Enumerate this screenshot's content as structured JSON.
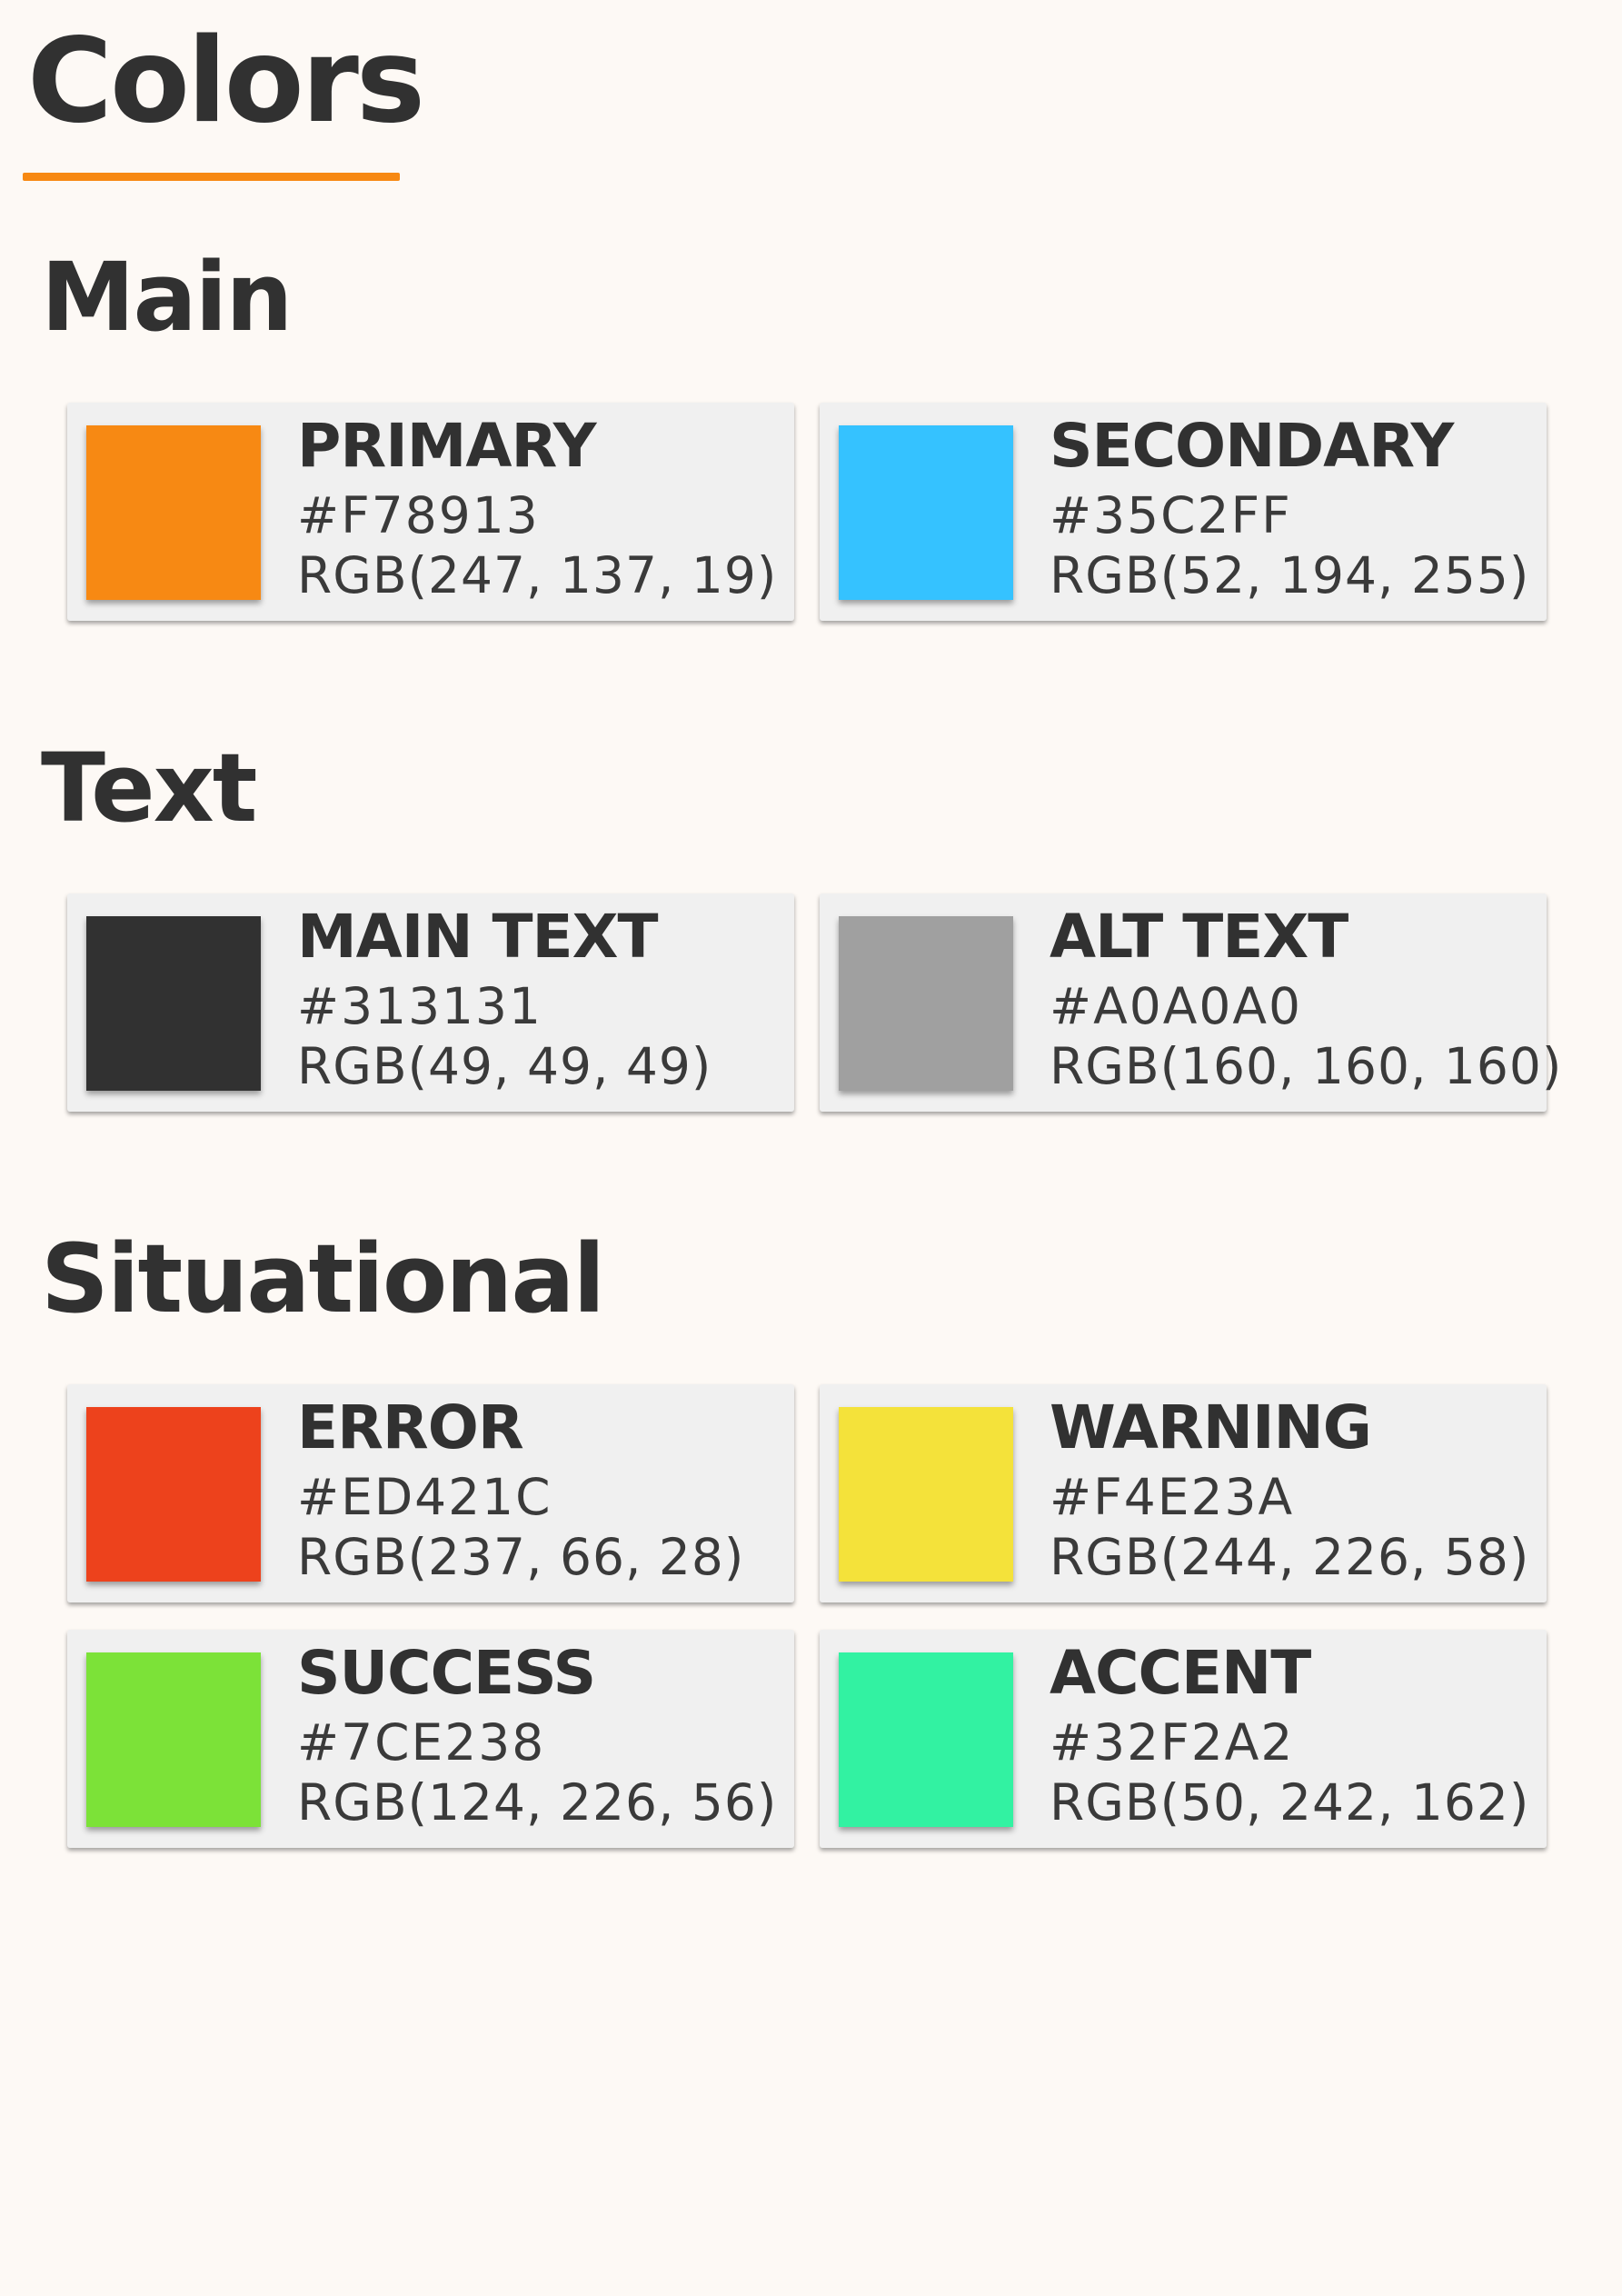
{
  "page": {
    "title": "Colors",
    "accent_color": "#f78913",
    "background_color": "#fdf9f5"
  },
  "sections": [
    {
      "heading": "Main",
      "cards": [
        {
          "name": "PRIMARY",
          "hex": "#F78913",
          "rgb": "RGB(247, 137, 19)",
          "color": "#F78913"
        },
        {
          "name": "SECONDARY",
          "hex": "#35C2FF",
          "rgb": "RGB(52, 194, 255)",
          "color": "#35C2FF"
        }
      ]
    },
    {
      "heading": "Text",
      "cards": [
        {
          "name": "MAIN TEXT",
          "hex": "#313131",
          "rgb": "RGB(49, 49, 49)",
          "color": "#313131"
        },
        {
          "name": "ALT TEXT",
          "hex": "#A0A0A0",
          "rgb": "RGB(160, 160, 160)",
          "color": "#A0A0A0"
        }
      ]
    },
    {
      "heading": "Situational",
      "cards": [
        {
          "name": "ERROR",
          "hex": "#ED421C",
          "rgb": "RGB(237, 66, 28)",
          "color": "#ED421C"
        },
        {
          "name": "WARNING",
          "hex": "#F4E23A",
          "rgb": "RGB(244, 226, 58)",
          "color": "#F4E23A"
        },
        {
          "name": "SUCCESS",
          "hex": "#7CE238",
          "rgb": "RGB(124, 226, 56)",
          "color": "#7CE238"
        },
        {
          "name": "ACCENT",
          "hex": "#32F2A2",
          "rgb": "RGB(50, 242, 162)",
          "color": "#32F2A2"
        }
      ]
    }
  ]
}
